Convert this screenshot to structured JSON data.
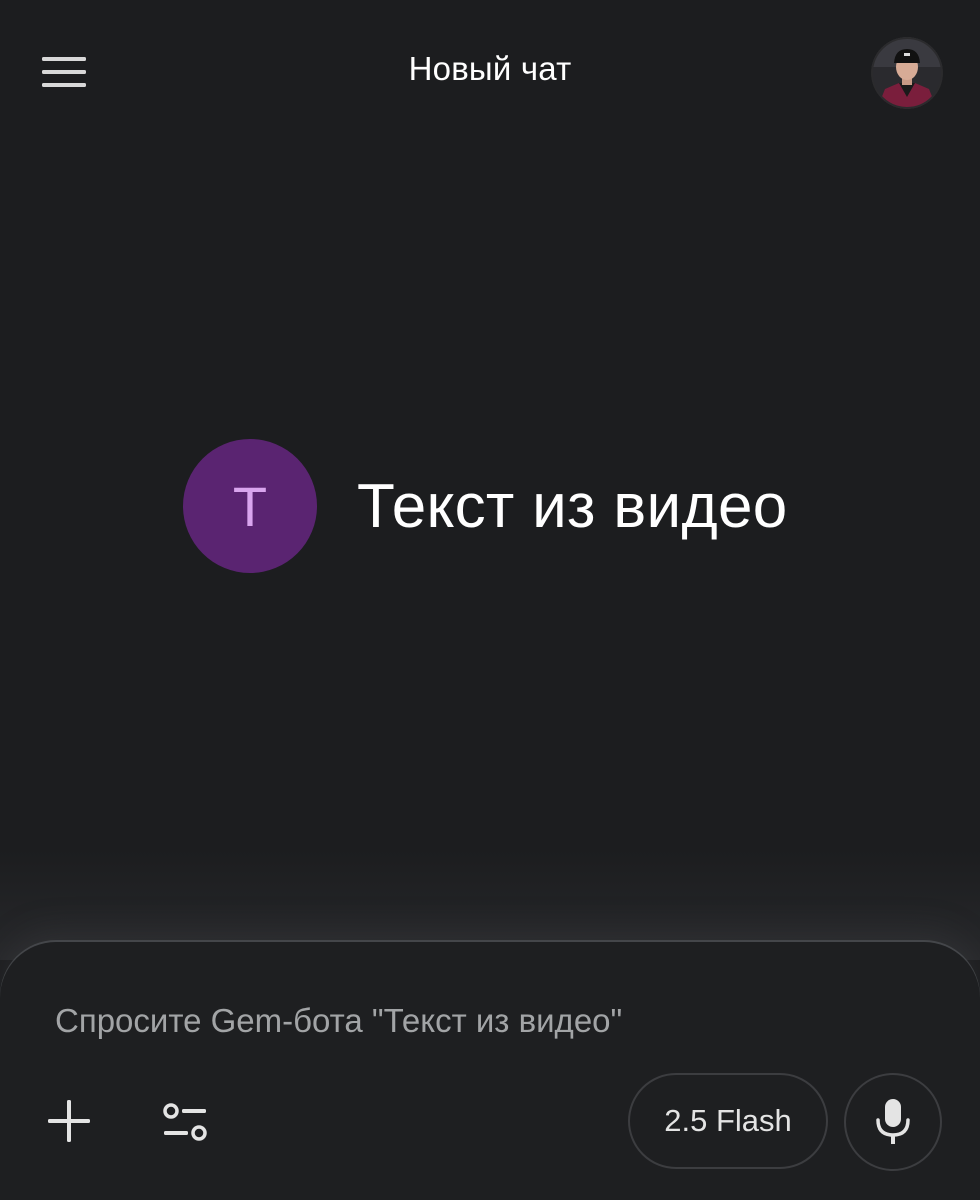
{
  "header": {
    "title": "Новый чат",
    "menu_icon": "hamburger-menu-icon",
    "avatar": "user-avatar"
  },
  "gem": {
    "initial": "Т",
    "name": "Текст из видео",
    "badge_color": "#5a2471",
    "initial_color": "#d9a5ee"
  },
  "composer": {
    "placeholder": "Спросите Gem-бота \"Текст из видео\"",
    "add_icon": "plus-icon",
    "tools_icon": "sliders-icon",
    "model_label": "2.5 Flash",
    "mic_icon": "microphone-icon"
  },
  "colors": {
    "background": "#1c1d1f",
    "panel": "#1e1f21",
    "text_primary": "#ffffff",
    "text_placeholder": "#a2a4a6"
  }
}
